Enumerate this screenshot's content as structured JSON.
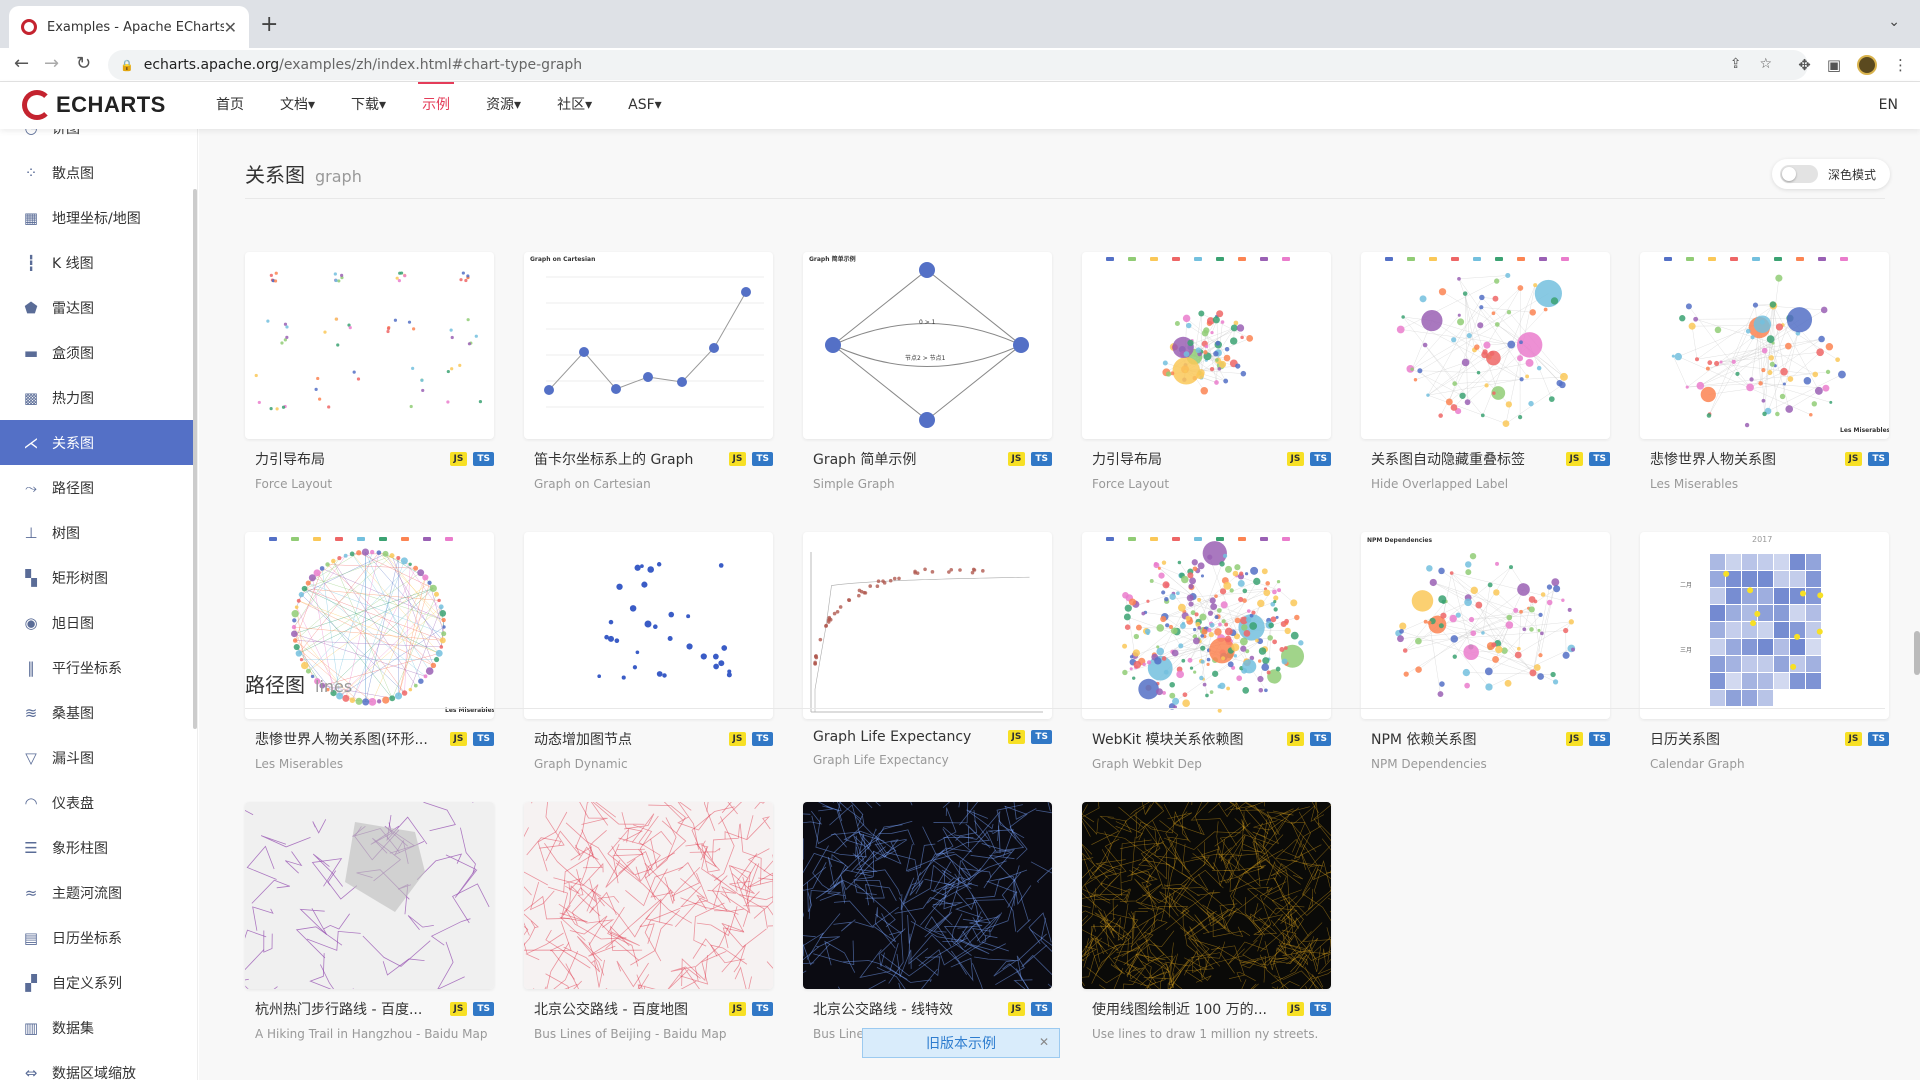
{
  "browser": {
    "tab_title": "Examples - Apache ECharts",
    "tab_close": "✕",
    "new_tab": "+",
    "url_host": "echarts.apache.org",
    "url_path": "/examples/zh/index.html#chart-type-graph"
  },
  "header": {
    "logo_text": "ECHARTS",
    "nav": [
      "首页",
      "文档▾",
      "下载▾",
      "示例",
      "资源▾",
      "社区▾",
      "ASF▾"
    ],
    "active_nav": "示例",
    "lang": "EN"
  },
  "sidebar": {
    "items": [
      {
        "label": "饼图",
        "icon": "pie-icon"
      },
      {
        "label": "散点图",
        "icon": "scatter-icon"
      },
      {
        "label": "地理坐标/地图",
        "icon": "map-icon"
      },
      {
        "label": "K 线图",
        "icon": "candlestick-icon"
      },
      {
        "label": "雷达图",
        "icon": "radar-icon"
      },
      {
        "label": "盒须图",
        "icon": "boxplot-icon"
      },
      {
        "label": "热力图",
        "icon": "heatmap-icon"
      },
      {
        "label": "关系图",
        "icon": "graph-icon"
      },
      {
        "label": "路径图",
        "icon": "lines-icon"
      },
      {
        "label": "树图",
        "icon": "tree-icon"
      },
      {
        "label": "矩形树图",
        "icon": "treemap-icon"
      },
      {
        "label": "旭日图",
        "icon": "sunburst-icon"
      },
      {
        "label": "平行坐标系",
        "icon": "parallel-icon"
      },
      {
        "label": "桑基图",
        "icon": "sankey-icon"
      },
      {
        "label": "漏斗图",
        "icon": "funnel-icon"
      },
      {
        "label": "仪表盘",
        "icon": "gauge-icon"
      },
      {
        "label": "象形柱图",
        "icon": "pictorial-bar-icon"
      },
      {
        "label": "主题河流图",
        "icon": "theme-river-icon"
      },
      {
        "label": "日历坐标系",
        "icon": "calendar-icon"
      },
      {
        "label": "自定义系列",
        "icon": "custom-icon"
      },
      {
        "label": "数据集",
        "icon": "dataset-icon"
      },
      {
        "label": "数据区域缩放",
        "icon": "datazoom-icon"
      }
    ],
    "active": "关系图"
  },
  "main": {
    "dark_mode_label": "深色模式",
    "sections": [
      {
        "zh": "关系图",
        "en": "graph",
        "cards": [
          {
            "title": "力引导布局",
            "sub": "Force Layout"
          },
          {
            "title": "笛卡尔坐标系上的 Graph",
            "sub": "Graph on Cartesian"
          },
          {
            "title": "Graph 简单示例",
            "sub": "Simple Graph"
          },
          {
            "title": "力引导布局",
            "sub": "Force Layout"
          },
          {
            "title": "关系图自动隐藏重叠标签",
            "sub": "Hide Overlapped Label"
          },
          {
            "title": "悲惨世界人物关系图",
            "sub": "Les Miserables"
          },
          {
            "title": "悲惨世界人物关系图(环形...",
            "sub": "Les Miserables"
          },
          {
            "title": "动态增加图节点",
            "sub": "Graph Dynamic"
          },
          {
            "title": "Graph Life Expectancy",
            "sub": "Graph Life Expectancy"
          },
          {
            "title": "WebKit 模块关系依赖图",
            "sub": "Graph Webkit Dep"
          },
          {
            "title": "NPM 依赖关系图",
            "sub": "NPM Dependencies"
          },
          {
            "title": "日历关系图",
            "sub": "Calendar Graph"
          }
        ]
      },
      {
        "zh": "路径图",
        "en": "lines",
        "cards": [
          {
            "title": "杭州热门步行路线 - 百度...",
            "sub": "A Hiking Trail in Hangzhou - Baidu Map"
          },
          {
            "title": "北京公交路线 - 百度地图",
            "sub": "Bus Lines of Beijing - Baidu Map"
          },
          {
            "title": "北京公交路线 - 线特效",
            "sub": "Bus Lines of Beijing - Line Effect"
          },
          {
            "title": "使用线图绘制近 100 万的...",
            "sub": "Use lines to draw 1 million ny streets."
          }
        ]
      }
    ],
    "badges": {
      "js": "JS",
      "ts": "TS"
    },
    "old_version": "旧版本示例",
    "old_version_close": "✕"
  },
  "thumb_text": {
    "cartesian_title": "Graph on Cartesian",
    "simple_title": "Graph 简单示例",
    "simple_edge1": "0 > 1",
    "simple_edge2": "节点2 > 节点1",
    "les_mis": "Les Miserables",
    "npm": "NPM Dependencies",
    "calendar_year": "2017",
    "calendar_m2": "二月",
    "calendar_m3": "三月"
  },
  "colors": {
    "brand_red": "#c4232f",
    "active_nav": "#e43c59",
    "sidebar_active": "#5470c6",
    "js_badge": "#f7e025",
    "ts_badge": "#3178c6"
  }
}
